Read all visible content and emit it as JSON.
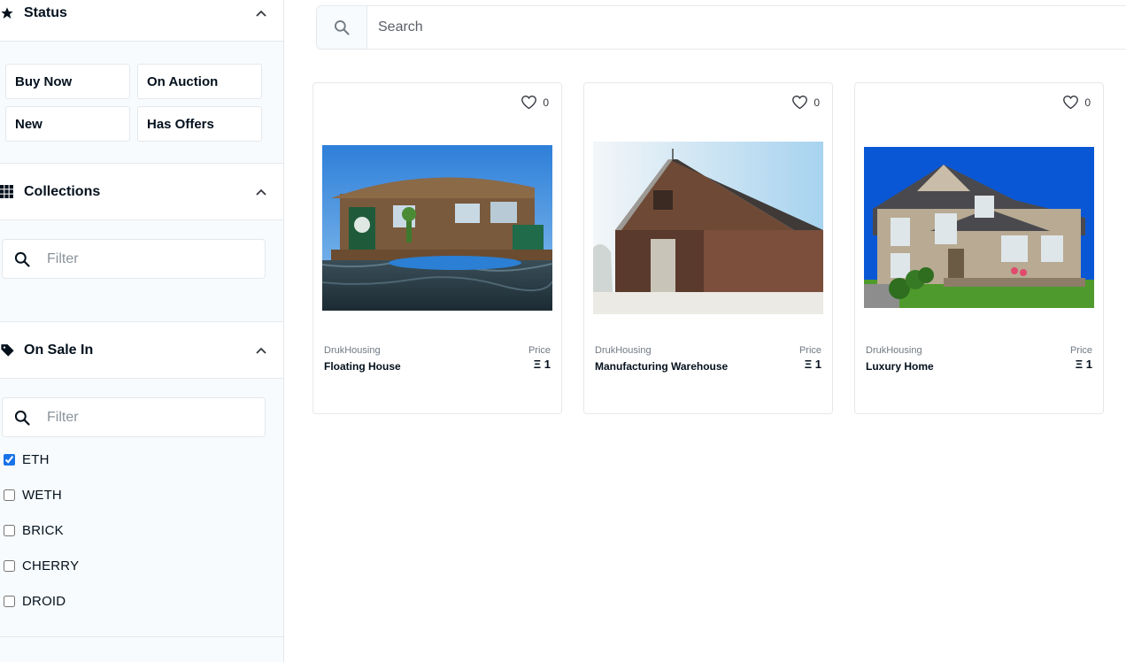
{
  "sidebar": {
    "status": {
      "title": "Status",
      "buttons": [
        "Buy Now",
        "On Auction",
        "New",
        "Has Offers"
      ]
    },
    "collections": {
      "title": "Collections",
      "filter_placeholder": "Filter"
    },
    "on_sale_in": {
      "title": "On Sale In",
      "filter_placeholder": "Filter",
      "currencies": [
        {
          "label": "ETH",
          "checked": true
        },
        {
          "label": "WETH",
          "checked": false
        },
        {
          "label": "BRICK",
          "checked": false
        },
        {
          "label": "CHERRY",
          "checked": false
        },
        {
          "label": "DROID",
          "checked": false
        }
      ]
    }
  },
  "search": {
    "placeholder": "Search"
  },
  "cards": [
    {
      "collection": "DrukHousing",
      "name": "Floating House",
      "price_label": "Price",
      "price": "Ξ 1",
      "likes": "0",
      "image": "houseboat-photo"
    },
    {
      "collection": "DrukHousing",
      "name": "Manufacturing Warehouse",
      "price_label": "Price",
      "price": "Ξ 1",
      "likes": "0",
      "image": "warehouse-photo"
    },
    {
      "collection": "DrukHousing",
      "name": "Luxury Home",
      "price_label": "Price",
      "price": "Ξ 1",
      "likes": "0",
      "image": "luxury-home-photo"
    }
  ],
  "colors": {
    "accent": "#1a73e8",
    "border": "#e5e8eb",
    "sidebar_bg": "#f7fbfd"
  }
}
